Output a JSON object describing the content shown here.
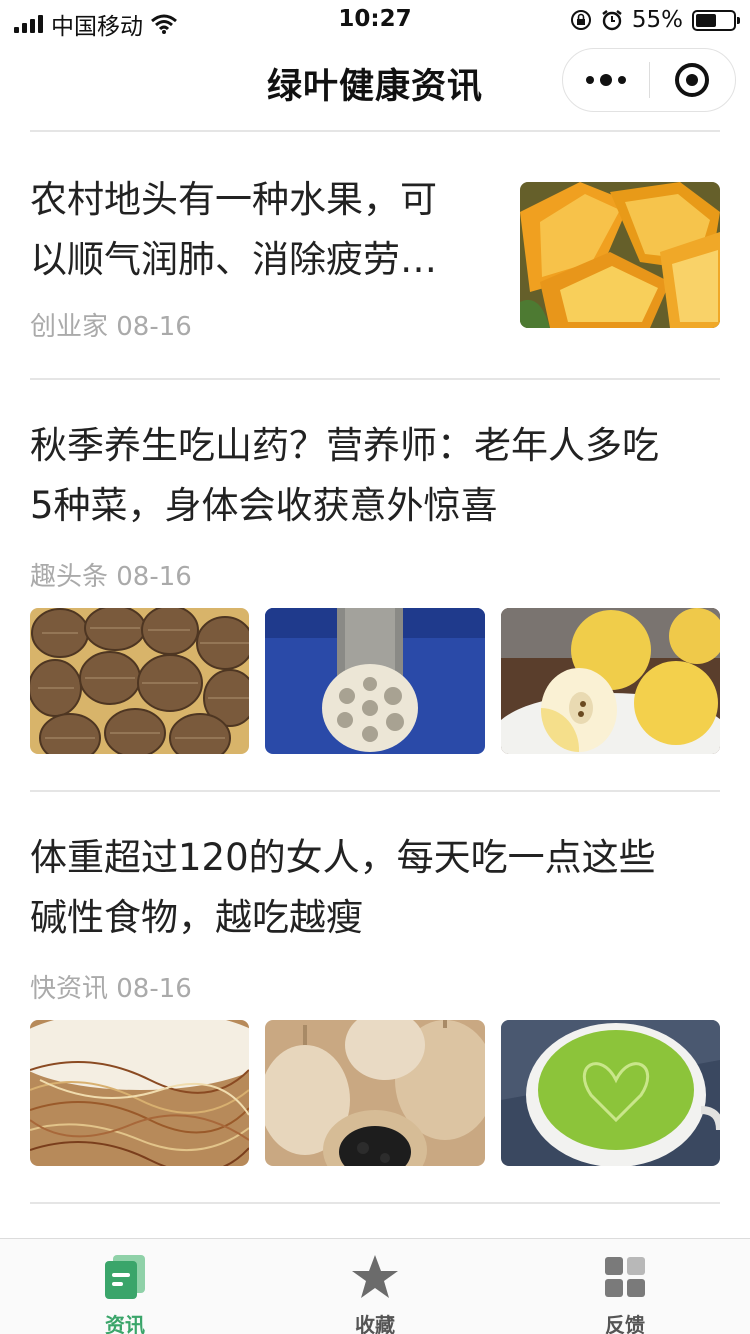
{
  "status_bar": {
    "carrier": "中国移动",
    "time": "10:27",
    "battery_percent": "55%",
    "battery_level": 0.55,
    "icons": [
      "signal-icon",
      "wifi-icon",
      "rotation-lock-icon",
      "alarm-icon",
      "battery-icon"
    ]
  },
  "nav": {
    "title": "绿叶健康资讯",
    "menu_icon": "more-dots-icon",
    "close_icon": "target-close-icon"
  },
  "articles": [
    {
      "title_lines": [
        "农村地头有一种水果，可",
        "以顺气润肺、消除疲劳…"
      ],
      "source": "创业家 08-16",
      "images": [
        "star-fruit-photo"
      ]
    },
    {
      "title_lines": [
        "秋季养生吃山药？营养师：老年人多吃",
        "5种菜，身体会收获意外惊喜"
      ],
      "source": "趣头条 08-16",
      "images": [
        "taro-photo",
        "lotus-root-photo",
        "asian-pear-photo"
      ]
    },
    {
      "title_lines": [
        "体重超过120的女人，每天吃一点这些",
        "碱性食物，越吃越瘦"
      ],
      "source": "快资讯 08-16",
      "images": [
        "corn-silk-photo",
        "black-garlic-photo",
        "matcha-latte-photo"
      ]
    }
  ],
  "tabbar": {
    "active": "资讯",
    "active_color": "#3aa56a",
    "inactive_color": "#666666",
    "tabs": [
      {
        "label": "资讯",
        "icon": "news-doc-icon"
      },
      {
        "label": "收藏",
        "icon": "star-icon"
      },
      {
        "label": "反馈",
        "icon": "grid-icon"
      }
    ]
  }
}
